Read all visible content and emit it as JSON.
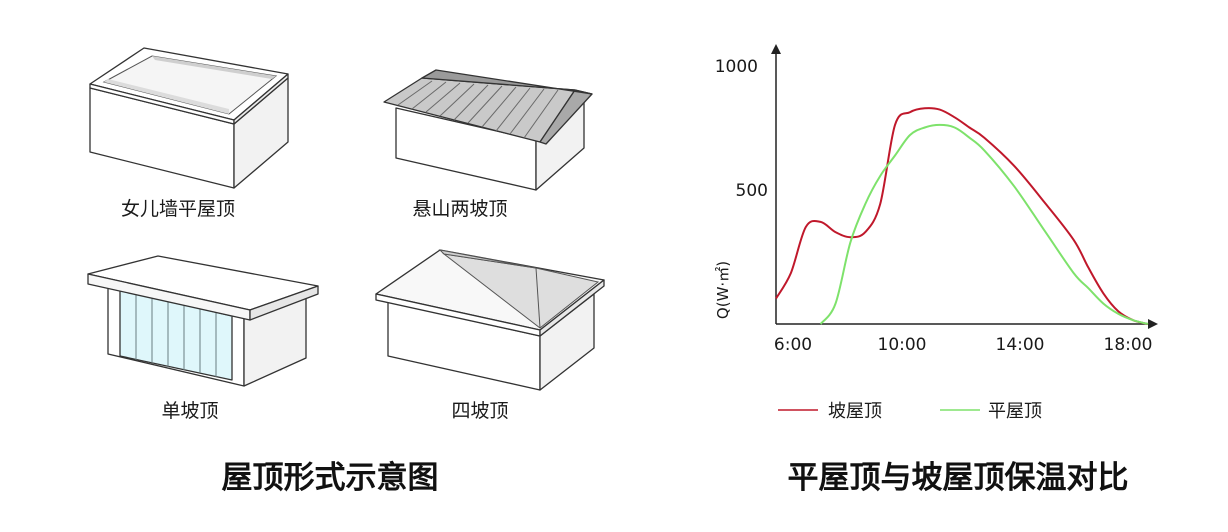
{
  "left_panel": {
    "title": "屋顶形式示意图",
    "roofs": [
      {
        "label": "女儿墙平屋顶"
      },
      {
        "label": "悬山两坡顶"
      },
      {
        "label": "单坡顶"
      },
      {
        "label": "四坡顶"
      }
    ]
  },
  "right_panel": {
    "title": "平屋顶与坡屋顶保温对比"
  },
  "colors": {
    "slope_roof": "#c0182b",
    "flat_roof": "#7ee26b",
    "glass": "#dff7fb"
  },
  "chart_data": {
    "type": "line",
    "ylabel": "Q(W·㎡)",
    "xlabel": "",
    "x_ticks": [
      "6:00",
      "10:00",
      "14:00",
      "18:00"
    ],
    "y_ticks": [
      "500",
      "1000"
    ],
    "xlim": [
      "6:00",
      "18:30"
    ],
    "ylim": [
      0,
      1050
    ],
    "series": [
      {
        "name": "坡屋顶",
        "color": "#c0182b",
        "x": [
          "6:00",
          "6:30",
          "7:00",
          "7:30",
          "8:00",
          "8:30",
          "9:00",
          "9:30",
          "10:00",
          "10:30",
          "11:00",
          "11:30",
          "12:00",
          "12:30",
          "13:00",
          "14:00",
          "15:00",
          "16:00",
          "16:30",
          "17:00",
          "17:30",
          "18:00",
          "18:30"
        ],
        "values": [
          100,
          200,
          380,
          400,
          360,
          340,
          360,
          470,
          780,
          830,
          845,
          840,
          810,
          770,
          730,
          620,
          480,
          330,
          220,
          120,
          50,
          15,
          0
        ]
      },
      {
        "name": "平屋顶",
        "color": "#7ee26b",
        "x": [
          "7:30",
          "8:00",
          "8:30",
          "9:00",
          "9:30",
          "10:00",
          "10:30",
          "11:00",
          "11:30",
          "12:00",
          "12:30",
          "13:00",
          "14:00",
          "15:00",
          "16:00",
          "16:30",
          "17:00",
          "17:30",
          "18:00",
          "18:30"
        ],
        "values": [
          0,
          80,
          320,
          470,
          580,
          660,
          740,
          770,
          780,
          770,
          730,
          680,
          540,
          370,
          200,
          140,
          80,
          40,
          15,
          0
        ]
      }
    ]
  }
}
